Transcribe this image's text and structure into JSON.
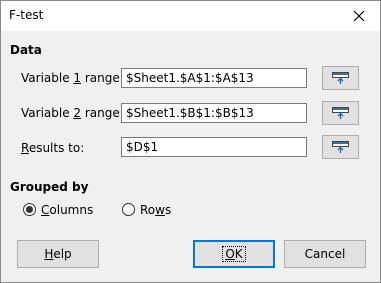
{
  "window": {
    "title": "F-test"
  },
  "data_section": {
    "heading": "Data",
    "var1": {
      "pre": "Variable ",
      "mnemonic": "1",
      "post": " range:",
      "value": "$Sheet1.$A$1:$A$13"
    },
    "var2": {
      "pre": "Variable ",
      "mnemonic": "2",
      "post": " range:",
      "value": "$Sheet1.$B$1:$B$13"
    },
    "results": {
      "pre": "",
      "mnemonic": "R",
      "post": "esults to:",
      "value": "$D$1"
    }
  },
  "grouped_section": {
    "heading": "Grouped by",
    "columns": {
      "mnemonic": "C",
      "rest": "olumns",
      "selected": true
    },
    "rows": {
      "pre": "Ro",
      "mnemonic": "w",
      "post": "s",
      "selected": false
    }
  },
  "buttons": {
    "help": {
      "mnemonic": "H",
      "rest": "elp"
    },
    "ok": {
      "mnemonic": "O",
      "rest": "K"
    },
    "cancel": {
      "label": "Cancel"
    }
  },
  "icons": {
    "close": "close-icon",
    "shrink": "shrink-range-icon"
  }
}
